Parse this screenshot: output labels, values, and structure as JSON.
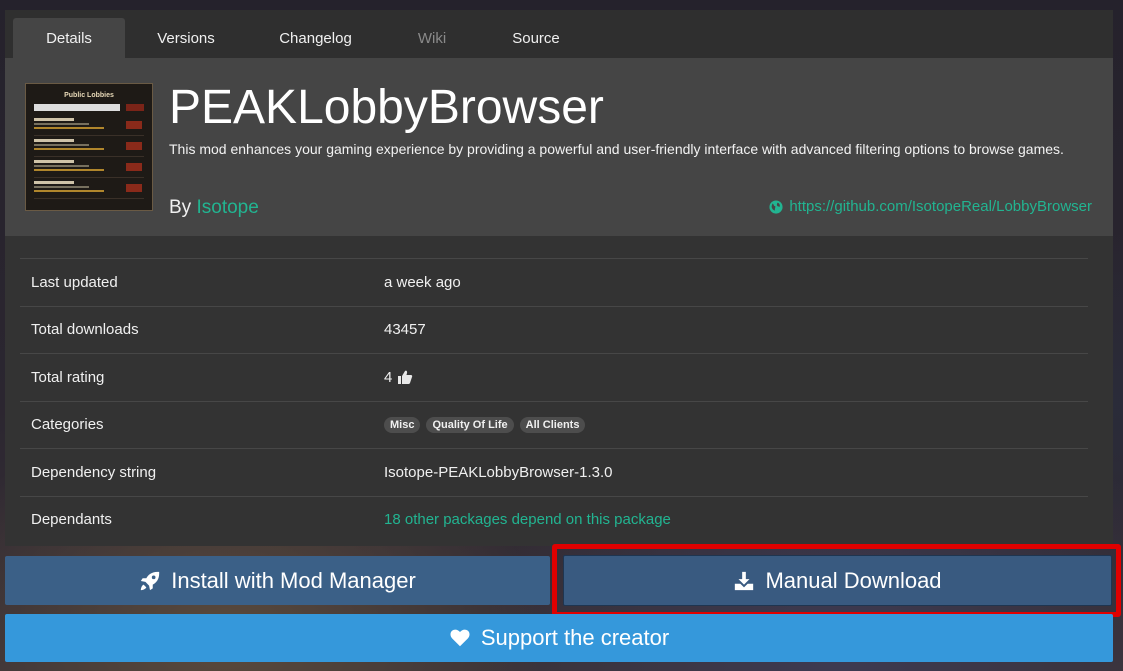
{
  "tabs": [
    {
      "label": "Details",
      "state": "active"
    },
    {
      "label": "Versions",
      "state": "normal"
    },
    {
      "label": "Changelog",
      "state": "normal"
    },
    {
      "label": "Wiki",
      "state": "disabled"
    },
    {
      "label": "Source",
      "state": "normal"
    }
  ],
  "package": {
    "name": "PEAKLobbyBrowser",
    "description": "This mod enhances your gaming experience by providing a powerful and user-friendly interface with advanced filtering options to browse games.",
    "by_label": "By",
    "author": "Isotope",
    "website": "https://github.com/IsotopeReal/LobbyBrowser",
    "thumbnail_title": "Public Lobbies"
  },
  "details": {
    "last_updated": {
      "label": "Last updated",
      "value": "a week ago"
    },
    "total_downloads": {
      "label": "Total downloads",
      "value": "43457"
    },
    "total_rating": {
      "label": "Total rating",
      "value": "4"
    },
    "categories": {
      "label": "Categories",
      "items": [
        "Misc",
        "Quality Of Life",
        "All Clients"
      ]
    },
    "dependency_string": {
      "label": "Dependency string",
      "value": "Isotope-PEAKLobbyBrowser-1.3.0"
    },
    "dependants": {
      "label": "Dependants",
      "value": "18 other packages depend on this package"
    }
  },
  "actions": {
    "install": "Install with Mod Manager",
    "manual_download": "Manual Download",
    "support": "Support the creator"
  },
  "colors": {
    "accent": "#22b491",
    "install_button": "#3b6087",
    "support_button": "#3598db",
    "highlight_border": "#e00000"
  }
}
